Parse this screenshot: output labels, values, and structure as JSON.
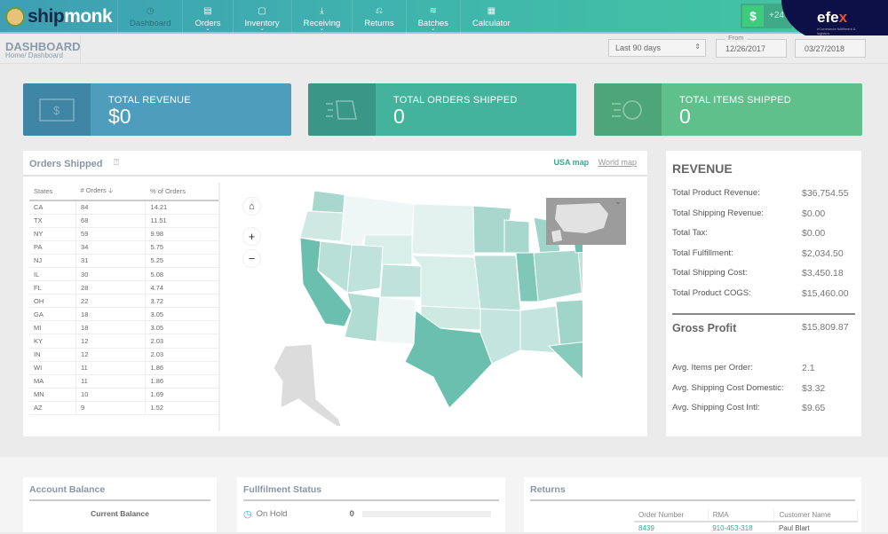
{
  "app": {
    "brand_part1": "ship",
    "brand_part2": "monk"
  },
  "nav": [
    {
      "label": "Dashboard",
      "icon": "dashboard-icon",
      "glyph": "◷",
      "active": true,
      "dropdown": false
    },
    {
      "label": "Orders",
      "icon": "orders-icon",
      "glyph": "▤",
      "active": false,
      "dropdown": true
    },
    {
      "label": "Inventory",
      "icon": "inventory-icon",
      "glyph": "▢",
      "active": false,
      "dropdown": true
    },
    {
      "label": "Receiving",
      "icon": "receiving-icon",
      "glyph": "⤓",
      "active": false,
      "dropdown": true
    },
    {
      "label": "Returns",
      "icon": "returns-icon",
      "glyph": "⎌",
      "active": false,
      "dropdown": false
    },
    {
      "label": "Batches",
      "icon": "batches-icon",
      "glyph": "≋",
      "active": false,
      "dropdown": true
    },
    {
      "label": "Calculator",
      "icon": "calculator-icon",
      "glyph": "▦",
      "active": false,
      "dropdown": false
    }
  ],
  "wallet": {
    "symbol": "$",
    "amount": "+24"
  },
  "watermark": {
    "name_a": "efe",
    "name_b": "x",
    "tagline": "eCommerce fulfillment & logistics"
  },
  "header": {
    "title": "DASHBOARD",
    "breadcrumb": "Home/ Dashboard"
  },
  "filters": {
    "range": "Last 90 days",
    "from_label": "From",
    "from": "12/26/2017",
    "to": "03/27/2018"
  },
  "cards": [
    {
      "label": "TOTAL REVENUE",
      "value": "$0",
      "color": "#4f9dbd",
      "icon_bg": "#3f86a4",
      "icon": "money-icon"
    },
    {
      "label": "TOTAL ORDERS SHIPPED",
      "value": "0",
      "color": "#44b39b",
      "icon_bg": "#3a9785",
      "icon": "orders-shipped-icon"
    },
    {
      "label": "TOTAL ITEMS SHIPPED",
      "value": "0",
      "color": "#5fc08b",
      "icon_bg": "#4ea577",
      "icon": "items-shipped-icon"
    }
  ],
  "orders_shipped": {
    "title": "Orders Shipped",
    "tabs": {
      "usa": "USA map",
      "world": "World map"
    },
    "columns": [
      "States",
      "# Orders",
      "% of Orders"
    ],
    "rows": [
      [
        "CA",
        "84",
        "14.21"
      ],
      [
        "TX",
        "68",
        "11.51"
      ],
      [
        "NY",
        "59",
        "9.98"
      ],
      [
        "PA",
        "34",
        "5.75"
      ],
      [
        "NJ",
        "31",
        "5.25"
      ],
      [
        "IL",
        "30",
        "5.08"
      ],
      [
        "FL",
        "28",
        "4.74"
      ],
      [
        "OH",
        "22",
        "3.72"
      ],
      [
        "GA",
        "18",
        "3.05"
      ],
      [
        "MI",
        "18",
        "3.05"
      ],
      [
        "KY",
        "12",
        "2.03"
      ],
      [
        "IN",
        "12",
        "2.03"
      ],
      [
        "WI",
        "11",
        "1.86"
      ],
      [
        "MA",
        "11",
        "1.86"
      ],
      [
        "MN",
        "10",
        "1.69"
      ],
      [
        "AZ",
        "9",
        "1.52"
      ]
    ],
    "map_colors": {
      "high": "#6bbfae",
      "mid": "#9fd5c9",
      "low": "#cde9e2",
      "min": "#eef7f5",
      "nodata": "#dcdcdc"
    }
  },
  "revenue": {
    "title": "REVENUE",
    "rows": [
      {
        "label": "Total Product Revenue:",
        "value": "$36,754.55"
      },
      {
        "label": "Total Shipping Revenue:",
        "value": "$0.00"
      },
      {
        "label": "Total Tax:",
        "value": "$0.00"
      },
      {
        "label": "Total Fulfillment:",
        "value": "$2,034.50"
      },
      {
        "label": "Total Shipping Cost:",
        "value": "$3,450.18"
      },
      {
        "label": "Total Product COGS:",
        "value": "$15,460.00"
      }
    ],
    "gross_profit_label": "Gross Profit",
    "gross_profit": "$15,809.87",
    "averages": [
      {
        "label": "Avg. Items per Order:",
        "value": "2.1"
      },
      {
        "label": "Avg. Shipping Cost Domestic:",
        "value": "$3.32"
      },
      {
        "label": "Avg. Shipping Cost Intl:",
        "value": "$9.65"
      }
    ]
  },
  "account_balance": {
    "title": "Account Balance",
    "current_label": "Current Balance"
  },
  "fulfillment": {
    "title": "Fullfilment Status",
    "items": [
      {
        "label": "On Hold",
        "count": "0",
        "progress": 0
      }
    ]
  },
  "returns": {
    "title": "Returns",
    "columns": [
      "Order Number",
      "RMA",
      "Customer Name"
    ],
    "rows": [
      [
        "8439",
        "910-453-318",
        "Paul Blart"
      ]
    ]
  }
}
